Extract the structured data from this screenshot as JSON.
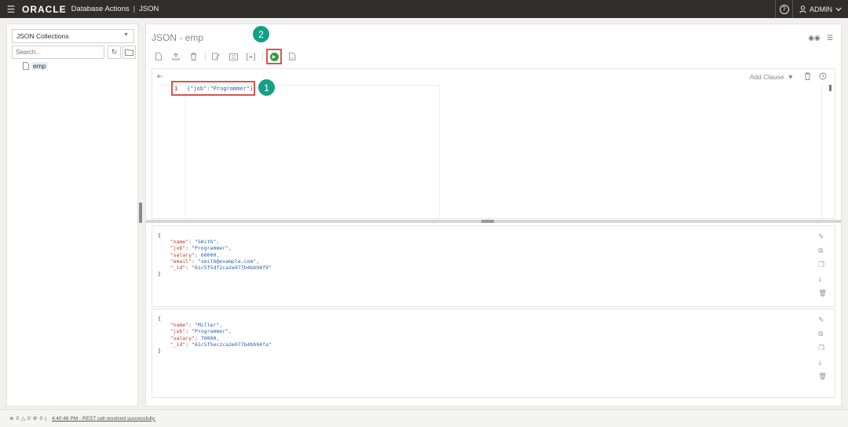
{
  "topbar": {
    "brand": "ORACLE",
    "product": "Database Actions",
    "separator": "|",
    "section": "JSON",
    "help_symbol": "?",
    "user_label": "ADMIN"
  },
  "left_panel": {
    "collection_selector": "JSON Collections",
    "search_placeholder": "Search...",
    "collections": [
      {
        "label": "emp"
      }
    ]
  },
  "main": {
    "title": "JSON - emp",
    "editor": {
      "line_number": "1",
      "code": "{\"job\":\"Programmer\"}",
      "add_clause_label": "Add Clause"
    },
    "callouts": [
      "1",
      "2"
    ],
    "results": [
      {
        "open": "{",
        "fields": [
          {
            "key": "\"name\"",
            "value": "\"Smith\","
          },
          {
            "key": "\"job\"",
            "value": "\"Programmer\","
          },
          {
            "key": "\"salary\"",
            "value": "60000,"
          },
          {
            "key": "\"email\"",
            "value": "\"smith@example.com\","
          },
          {
            "key": "\"_id\"",
            "value": "\"61c5f5df2ca2e077b4bb94f9\""
          }
        ],
        "close": "}"
      },
      {
        "open": "{",
        "fields": [
          {
            "key": "\"name\"",
            "value": "\"Miller\","
          },
          {
            "key": "\"job\"",
            "value": "\"Programmer\","
          },
          {
            "key": "\"salary\"",
            "value": "70000,"
          },
          {
            "key": "\"_id\"",
            "value": "\"61c5f5ec2ca2e077b4bb94fa\""
          }
        ],
        "close": "}"
      }
    ]
  },
  "statusbar": {
    "errors": "0",
    "warnings": "0",
    "processes": "0",
    "message": "4:40:48 PM - REST call resolved successfully."
  },
  "colors": {
    "topbar_bg": "#312d2a",
    "run_green": "#2e9e3e",
    "highlight_red": "#d9534f",
    "callout_teal": "#13a085"
  }
}
